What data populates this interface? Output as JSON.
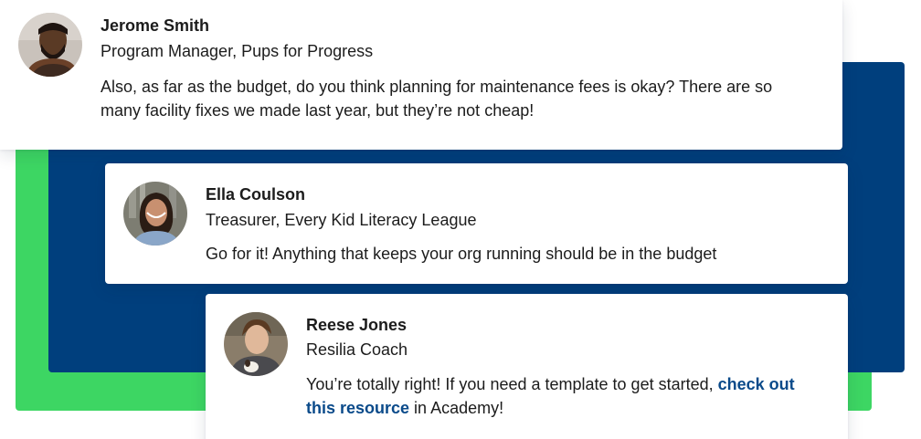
{
  "colors": {
    "green_panel": "#3dd663",
    "navy_panel": "#003f7d",
    "link": "#0a4a8a"
  },
  "messages": [
    {
      "avatar_icon": "person-avatar-jerome",
      "name": "Jerome Smith",
      "role": "Program Manager, Pups for Progress",
      "text": "Also, as far as the budget, do you think planning for maintenance fees is okay? There are so many facility fixes we made last year, but they’re not cheap!"
    },
    {
      "avatar_icon": "person-avatar-ella",
      "name": "Ella Coulson",
      "role": "Treasurer, Every Kid Literacy League",
      "text": "Go for it! Anything that keeps your org running should be in the budget"
    },
    {
      "avatar_icon": "person-avatar-reese",
      "name": "Reese Jones",
      "role": "Resilia Coach",
      "text_before": "You’re totally right! If you need a template to get started, ",
      "link_text": "check out this resource",
      "text_after": " in Academy!"
    }
  ]
}
